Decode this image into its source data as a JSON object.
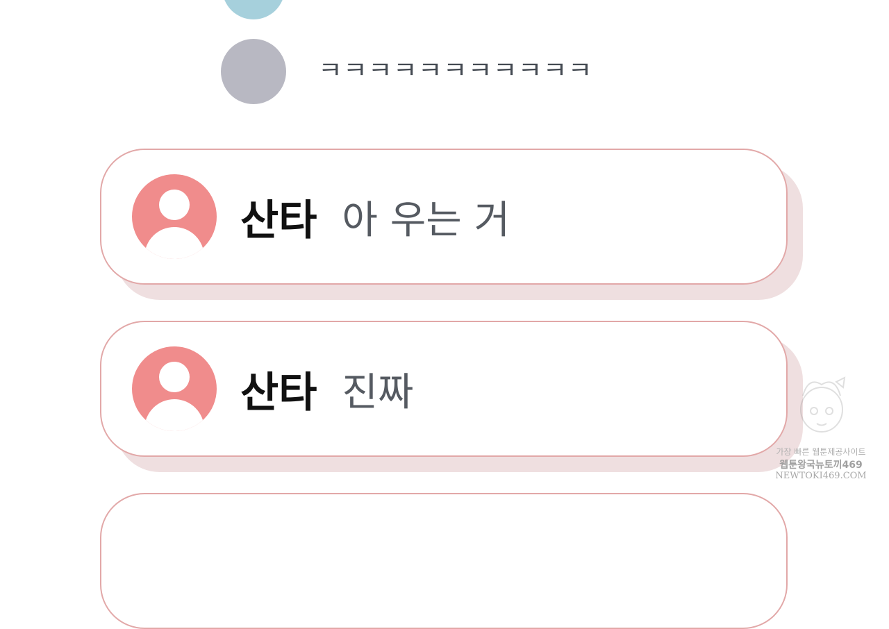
{
  "chat_above": {
    "text": "ㅋㅋㅋㅋㅋㅋㅋㅋㅋㅋㅋ"
  },
  "messages": [
    {
      "sender": "산타",
      "text": "아 우는 거",
      "avatar_icon": "person-icon"
    },
    {
      "sender": "산타",
      "text": "진짜",
      "avatar_icon": "person-icon"
    }
  ],
  "watermark": {
    "line1": "가장 빠른 웹툰제공사이트",
    "line2": "웹툰왕국뉴토끼469",
    "line3": "NEWTOKI469.COM"
  },
  "colors": {
    "card_border": "#e2a8a8",
    "card_shadow": "#efdfe0",
    "avatar_pink": "#f08c8c",
    "avatar_gray": "#b8b8c2",
    "avatar_blue": "#a6d0dc"
  }
}
